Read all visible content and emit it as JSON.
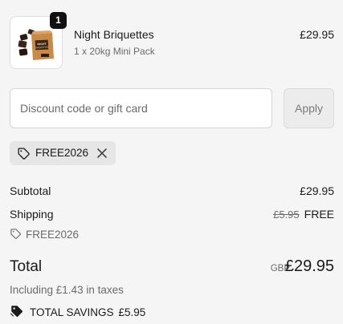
{
  "product": {
    "quantity": "1",
    "name": "Night Briquettes",
    "variant": "1 x 20kg Mini Pack",
    "price": "£29.95",
    "image_icon": "briquette-bag-icon",
    "image_text": "NIGHT BRIQUETTES"
  },
  "discount": {
    "placeholder": "Discount code or gift card",
    "value": "",
    "apply_label": "Apply"
  },
  "applied_code": {
    "code": "FREE2026",
    "icon": "tag-icon",
    "remove_icon": "close-icon"
  },
  "totals": {
    "subtotal_label": "Subtotal",
    "subtotal_value": "£29.95",
    "shipping_label": "Shipping",
    "shipping_original": "£5.95",
    "shipping_value": "FREE",
    "shipping_code": "FREE2026",
    "total_label": "Total",
    "currency": "GBP",
    "total_value": "£29.95",
    "tax_note": "Including £1.43 in taxes",
    "savings_label": "TOTAL SAVINGS",
    "savings_value": "£5.95"
  },
  "colors": {
    "background": "#f5f5f5",
    "badge": "#111111",
    "chip": "#e6e6e6",
    "muted_text": "#6b6b6b",
    "product_box": "#c98a45"
  }
}
